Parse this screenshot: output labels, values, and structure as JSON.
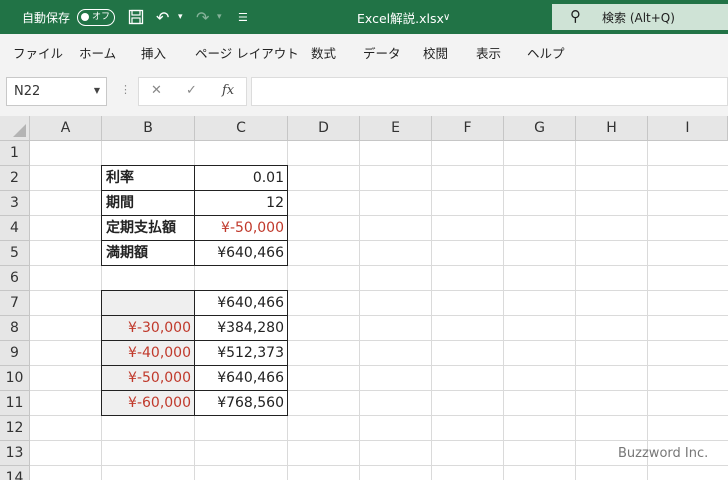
{
  "titlebar": {
    "autosave_label": "自動保存",
    "autosave_state": "オフ",
    "filename": "Excel解説.xlsx",
    "search_text": "検索 (Alt+Q)"
  },
  "ribbon": {
    "tabs": [
      "ファイル",
      "ホーム",
      "挿入",
      "ページ レイアウト",
      "数式",
      "データ",
      "校閲",
      "表示",
      "ヘルプ"
    ]
  },
  "formula_bar": {
    "name_box": "N22",
    "fx_label": "fx",
    "formula": ""
  },
  "grid": {
    "columns": [
      "A",
      "B",
      "C",
      "D",
      "E",
      "F",
      "G",
      "H",
      "I"
    ],
    "rows": [
      "1",
      "2",
      "3",
      "4",
      "5",
      "6",
      "7",
      "8",
      "9",
      "10",
      "11",
      "12",
      "13",
      "14"
    ],
    "cells": {
      "B2": "利率",
      "C2": "0.01",
      "B3": "期間",
      "C3": "12",
      "B4": "定期支払額",
      "C4": "¥-50,000",
      "B5": "満期額",
      "C5": "¥640,466",
      "B7": "",
      "C7": "¥640,466",
      "B8": "¥-30,000",
      "C8": "¥384,280",
      "B9": "¥-40,000",
      "C9": "¥512,373",
      "B10": "¥-50,000",
      "C10": "¥640,466",
      "B11": "¥-60,000",
      "C11": "¥768,560"
    }
  },
  "colors": {
    "titlebar_bg": "#217346",
    "negative_text": "#c0392b"
  },
  "watermark": "Buzzword Inc."
}
